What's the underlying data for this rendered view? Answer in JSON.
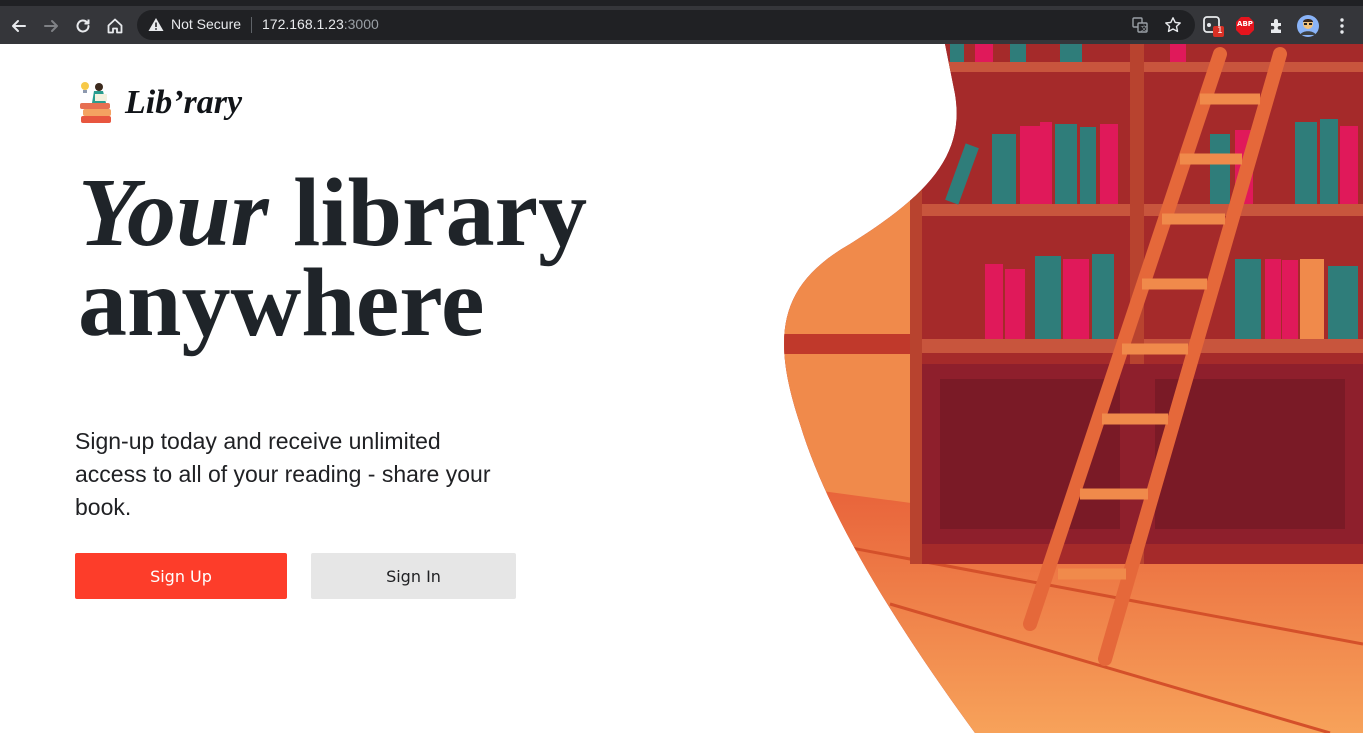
{
  "browser": {
    "security_label": "Not Secure",
    "url_host": "172.168.1.23",
    "url_port": ":3000",
    "extension_badge_count": "1",
    "abp_label": "ABP"
  },
  "brand": {
    "name": "Lib’rary"
  },
  "hero": {
    "line1_em": "Your",
    "line1_rest": "library",
    "line2": "anywhere"
  },
  "description": "Sign-up today and receive unlimited access to all of your reading - share your book.",
  "buttons": {
    "signup": "Sign Up",
    "signin": "Sign In"
  },
  "colors": {
    "primary": "#fd3d2a",
    "secondary_button": "#e6e6e6",
    "heading": "#1f2429",
    "illustration_bg": "#9b1b30"
  }
}
